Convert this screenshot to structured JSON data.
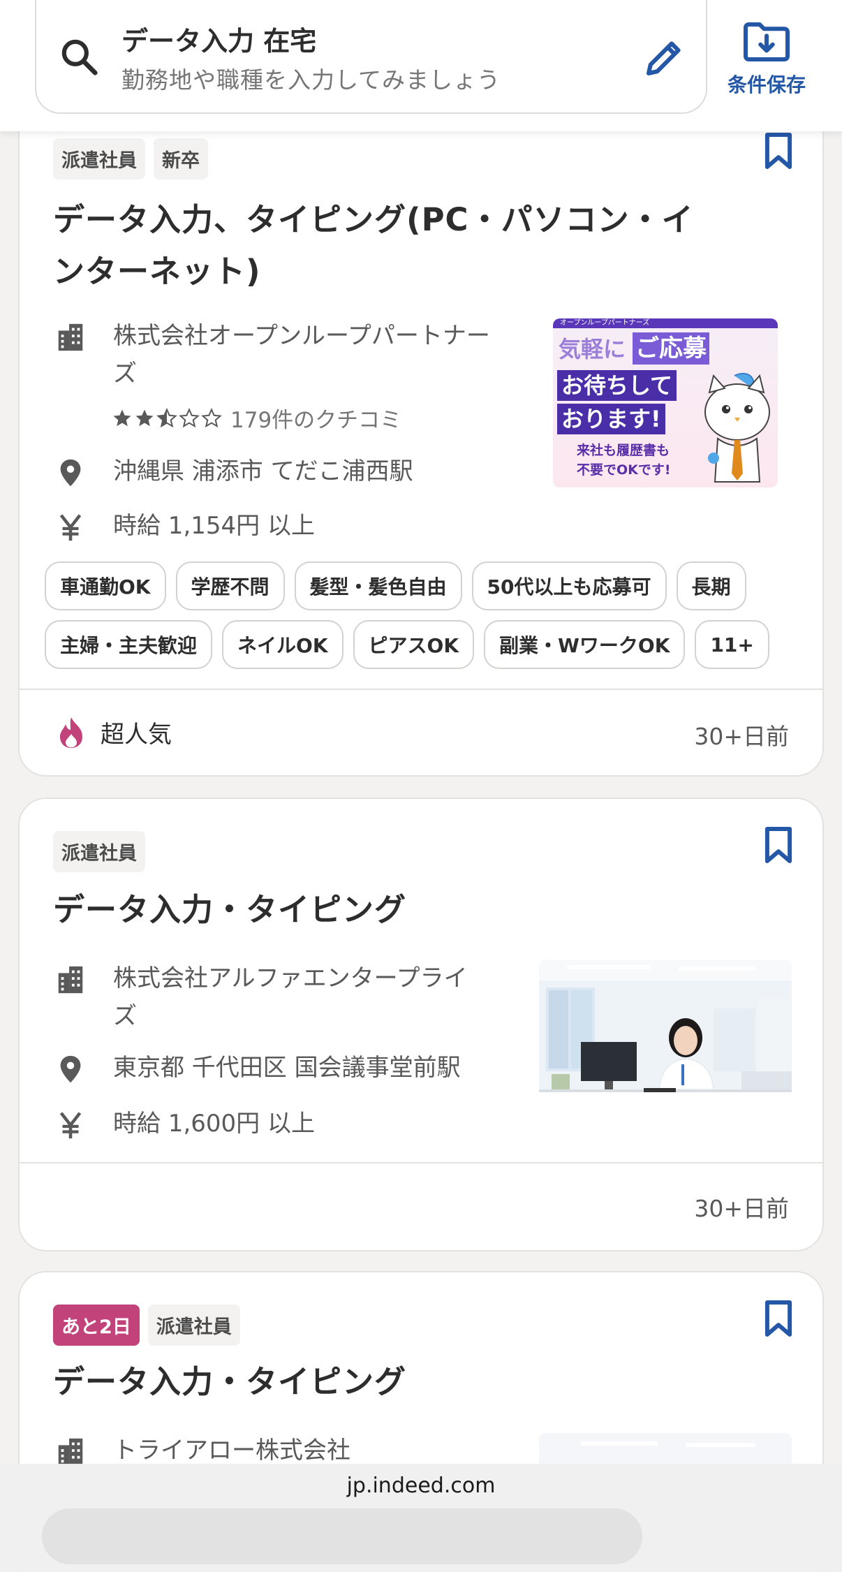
{
  "search": {
    "query": "データ入力 在宅",
    "placeholder": "勤務地や職種を入力してみましょう",
    "save_label": "条件保存"
  },
  "jobs": [
    {
      "badges": [
        "派遣社員",
        "新卒"
      ],
      "title": "データ入力、タイピング(PC・パソコン・インターネット)",
      "company": "株式会社オープンループパートナーズ",
      "rating": 2.5,
      "reviews": "179件のクチコミ",
      "location": "沖縄県 浦添市 てだこ浦西駅",
      "salary": "時給 1,154円 以上",
      "tags": [
        "車通勤OK",
        "学歴不問",
        "髪型・髪色自由",
        "50代以上も応募可",
        "長期",
        "主婦・主夫歓迎",
        "ネイルOK",
        "ピアスOK",
        "副業・WワークOK",
        "11+"
      ],
      "popularity": "超人気",
      "posted": "30+日前",
      "thumb": {
        "header": "オープンループパートナーズ",
        "line1a": "気軽に",
        "line1b": "ご応募",
        "line2": "お待ちして",
        "line3": "おります!",
        "line4": "来社も履歴書も",
        "line5": "不要でOKです!"
      }
    },
    {
      "badges": [
        "派遣社員"
      ],
      "title": "データ入力・タイピング",
      "company": "株式会社アルファエンタープライズ",
      "location": "東京都 千代田区 国会議事堂前駅",
      "salary": "時給 1,600円 以上",
      "posted": "30+日前"
    },
    {
      "badges": [
        "あと2日",
        "派遣社員"
      ],
      "title": "データ入力・タイピング",
      "company": "トライアロー株式会社"
    }
  ],
  "browser": {
    "url": "jp.indeed.com"
  },
  "colors": {
    "accent": "#2557a7",
    "urgent": "#c2427a",
    "popular": "#c2427a",
    "thumb_purple": "#4a2ea8"
  }
}
